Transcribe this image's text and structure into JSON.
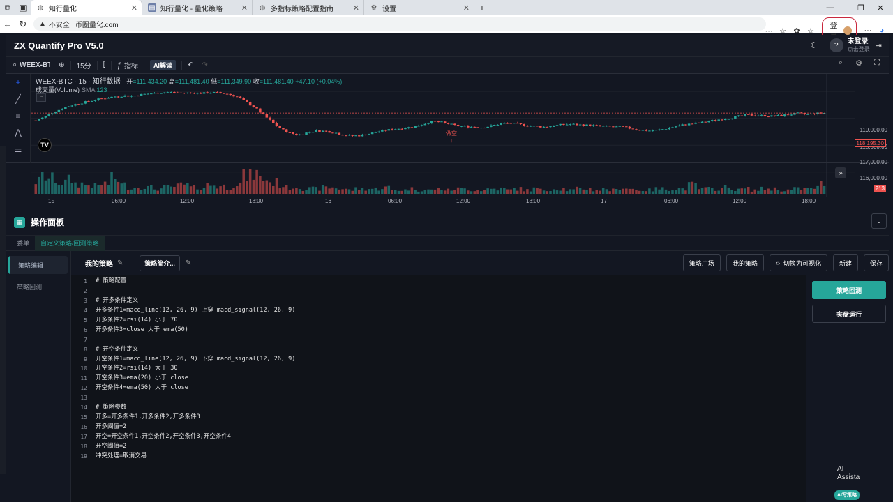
{
  "browser": {
    "tabs": [
      {
        "label": "知行量化",
        "active": true
      },
      {
        "label": "知行量化 - 量化策略",
        "active": false
      },
      {
        "label": "多指标策略配置指南",
        "active": false
      },
      {
        "label": "设置",
        "active": false
      }
    ],
    "security_label": "不安全",
    "url": "币圈量化.com",
    "login_label": "登录"
  },
  "app": {
    "title": "ZX Quantify Pro V5.0",
    "user_status": "未登录",
    "user_hint": "点击登录",
    "help": "?"
  },
  "toolbar": {
    "symbol": "WEEX-BTC",
    "interval": "15分",
    "indicators": "指标",
    "ai_label": "AI解读"
  },
  "chart": {
    "legend_symbol": "WEEX-BTC · 15 · 知行数据",
    "open_k": "开",
    "open": "=111,434.20",
    "high_k": "高",
    "high": "=111,481.40",
    "low_k": "低",
    "low": "=111,349.90",
    "close_k": "收",
    "close": "=111,481.40",
    "change": "+47.10 (+0.04%)",
    "volume_label": "成交量(Volume)",
    "sma_label": "SMA",
    "sma_value": "123",
    "short_marker": "做空",
    "last_price": "118,195.30",
    "volume_tag": "213",
    "logo": "TV",
    "price_ticks": [
      "119,000.00",
      "118,000.00",
      "117,000.00",
      "116,000.00"
    ],
    "time_ticks": [
      "15",
      "06:00",
      "12:00",
      "18:00",
      "16",
      "06:00",
      "12:00",
      "18:00",
      "17",
      "06:00",
      "12:00",
      "18:00"
    ]
  },
  "chart_data": {
    "type": "candlestick",
    "title": "WEEX-BTC · 15 · 知行数据",
    "y_range": [
      115500,
      119600
    ],
    "price_series": [
      117920,
      118050,
      118230,
      118360,
      118480,
      118560,
      118630,
      118700,
      118760,
      118810,
      118840,
      118830,
      118880,
      118920,
      118950,
      118970,
      118960,
      118940,
      118950,
      118930,
      118960,
      118940,
      118900,
      118800,
      118600,
      118400,
      118120,
      117850,
      117600,
      117450,
      117380,
      117470,
      117540,
      117520,
      117480,
      117390,
      117350,
      117360,
      117420,
      117500,
      117560,
      117600,
      117640,
      117680,
      117760,
      117870,
      117870,
      117800,
      117720,
      117700,
      117680,
      117660,
      117720,
      117800,
      117820,
      117780,
      117740,
      117700,
      117680,
      117720,
      117760,
      117780,
      117760,
      117740,
      117720,
      117700,
      117680,
      117680,
      117620,
      117560,
      117540,
      117560,
      117620,
      117700,
      117760,
      117800,
      117840,
      117900,
      117960,
      118000,
      118060,
      118120,
      118120,
      118100,
      118080,
      118100,
      118140,
      118180,
      118140,
      118180,
      118195.3
    ],
    "volume_scale": 1,
    "volume_series": [
      20,
      28,
      24,
      18,
      22,
      16,
      14,
      12,
      16,
      24,
      14,
      10,
      12,
      10,
      8,
      10,
      12,
      14,
      10,
      10,
      14,
      12,
      10,
      16,
      28,
      32,
      24,
      18,
      14,
      10,
      12,
      8,
      8,
      10,
      10,
      8,
      6,
      8,
      8,
      8,
      10,
      6,
      6,
      8,
      6,
      6,
      8,
      6,
      8,
      8,
      6,
      6,
      8,
      8,
      6,
      8,
      6,
      8,
      6,
      8,
      8,
      6,
      8,
      8,
      6,
      8,
      6,
      10,
      8,
      6,
      6,
      8,
      8,
      8,
      8,
      14,
      8,
      8,
      8,
      10,
      6,
      8,
      6,
      8,
      8,
      6,
      6,
      8,
      8,
      10,
      16
    ]
  },
  "panel": {
    "title": "操作面板",
    "tabs": [
      "委单",
      "自定义策略/回测策略"
    ],
    "active_tab": 1,
    "left_nav": [
      "策略编辑",
      "策略回测"
    ],
    "strategy_name": "我的策略",
    "intro_label": "策略简介...",
    "buttons": {
      "plaza": "策略广场",
      "mine": "我的策略",
      "visual": "切换为可视化",
      "new": "新建",
      "save": "保存"
    },
    "backtest": "策略回测",
    "live_run": "实盘运行",
    "ai_assistant": "AI Assista",
    "ai_strategy": "AI写策略"
  },
  "code_lines": [
    "# 策略配置",
    "",
    "# 开多条件定义",
    "开多条件1=macd_line(12, 26, 9) 上穿 macd_signal(12, 26, 9)",
    "开多条件2=rsi(14) 小于 70",
    "开多条件3=close 大于 ema(50)",
    "",
    "# 开空条件定义",
    "开空条件1=macd_line(12, 26, 9) 下穿 macd_signal(12, 26, 9)",
    "开空条件2=rsi(14) 大于 30",
    "开空条件3=ema(20) 小于 close",
    "开空条件4=ema(50) 大于 close",
    "",
    "# 策略参数",
    "开多=开多条件1,开多条件2,开多条件3",
    "开多阈值=2",
    "开空=开空条件1,开空条件2,开空条件3,开空条件4",
    "开空阈值=2",
    "冲突处理=取消交易"
  ]
}
